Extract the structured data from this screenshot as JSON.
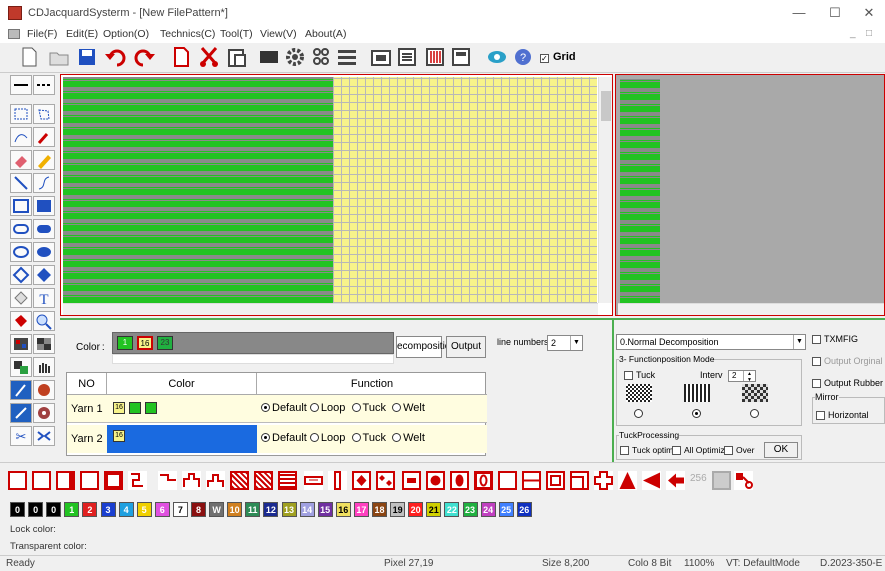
{
  "window": {
    "title": "CDJacquardSysterm - [New FilePattern*]",
    "min": "—",
    "max": "☐",
    "close": "✕"
  },
  "menu": [
    "File(F)",
    "Edit(E)",
    "Option(O)",
    "Technics(C)",
    "Tool(T)",
    "View(V)",
    "About(A)"
  ],
  "toolbar": {
    "grid_label": "Grid",
    "grid_checked": true
  },
  "panel": {
    "color_label": "Color :",
    "color_chips": [
      "1",
      "16",
      "23"
    ],
    "decomposition_button": "ecompositio",
    "output_button": "Output",
    "line_numbers_label": "line numbers",
    "line_numbers_value": "2",
    "table": {
      "headers": [
        "NO",
        "Color",
        "Function"
      ],
      "rows": [
        {
          "no": "Yarn 1",
          "chips": [
            "16",
            "",
            ""
          ],
          "function_selected": "Default"
        },
        {
          "no": "Yarn 2",
          "chips": [
            "16"
          ],
          "function_selected": "Default"
        }
      ],
      "function_options": [
        "Default",
        "Loop",
        "Tuck",
        "Welt"
      ]
    },
    "decomposition_select": "0.Normal Decomposition",
    "functionposition_group": "3- Functionposition Mode",
    "tuck_label": "Tuck",
    "interv_label": "Interv",
    "interv_value": "2",
    "tuckprocessing_group": "TuckProcessing",
    "tuck_optim_label": "Tuck optim",
    "all_optimiz_label": "All Optimiz",
    "over_label": "Over",
    "ok_button": "OK",
    "txmfig_label": "TXMFIG",
    "output_orginal_label": "Output Orginal",
    "output_rubber_label": "Output Rubber",
    "mirror_group": "Mirror",
    "horizontal_label": "Horizontal"
  },
  "shapes_strip": {
    "number_256": "256"
  },
  "color_strip": {
    "items": [
      {
        "label": "0",
        "color": "#000000"
      },
      {
        "label": "0",
        "color": "#000000"
      },
      {
        "label": "0",
        "color": "#000000"
      },
      {
        "label": "1",
        "color": "#22c322"
      },
      {
        "label": "2",
        "color": "#e02020"
      },
      {
        "label": "3",
        "color": "#1a3fd0"
      },
      {
        "label": "4",
        "color": "#1fa0e0"
      },
      {
        "label": "5",
        "color": "#f0d000"
      },
      {
        "label": "6",
        "color": "#e050e0"
      },
      {
        "label": "7",
        "color": "#ffffff"
      },
      {
        "label": "8",
        "color": "#8a1010"
      },
      {
        "label": "W",
        "color": "#707070"
      },
      {
        "label": "10",
        "color": "#d08020"
      },
      {
        "label": "11",
        "color": "#2e8b57"
      },
      {
        "label": "12",
        "color": "#1a2a90"
      },
      {
        "label": "13",
        "color": "#a0a020"
      },
      {
        "label": "14",
        "color": "#a0a0e0"
      },
      {
        "label": "15",
        "color": "#7030a0"
      },
      {
        "label": "16",
        "color": "#f0e060"
      },
      {
        "label": "17",
        "color": "#ff40c0"
      },
      {
        "label": "18",
        "color": "#8b4513"
      },
      {
        "label": "19",
        "color": "#c0c0c0"
      },
      {
        "label": "20",
        "color": "#ff2020"
      },
      {
        "label": "21",
        "color": "#d0d000"
      },
      {
        "label": "22",
        "color": "#40e0d0"
      },
      {
        "label": "23",
        "color": "#20b040"
      },
      {
        "label": "24",
        "color": "#c040c0"
      },
      {
        "label": "25",
        "color": "#4080ff"
      },
      {
        "label": "26",
        "color": "#1030c0"
      }
    ]
  },
  "lock_color_label": "Lock color:",
  "transparent_color_label": "Transparent color:",
  "status": {
    "state": "Ready",
    "pixel": "Pixel 27,19",
    "size": "Size 8,200",
    "color_bits": "Colo 8 Bit",
    "zoom": "1100%",
    "vt": "VT: DefaultMode",
    "date": "D.2023-350-E"
  }
}
